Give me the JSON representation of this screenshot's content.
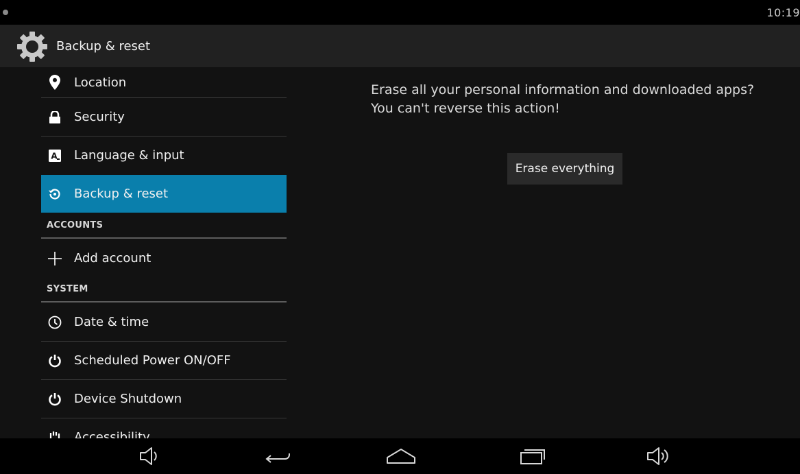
{
  "status_bar": {
    "time": "10:19"
  },
  "action_bar": {
    "title": "Backup & reset",
    "icon": "settings-gear-icon"
  },
  "sidebar": {
    "items": [
      {
        "label": "Location",
        "icon": "location-pin-icon"
      },
      {
        "label": "Security",
        "icon": "lock-icon"
      },
      {
        "label": "Language & input",
        "icon": "keyboard-letter-icon"
      },
      {
        "label": "Backup & reset",
        "icon": "backup-restore-icon",
        "selected": true
      },
      {
        "label": "Add account",
        "icon": "plus-icon"
      },
      {
        "label": "Date & time",
        "icon": "clock-icon"
      },
      {
        "label": "Scheduled Power ON/OFF",
        "icon": "power-icon"
      },
      {
        "label": "Device Shutdown",
        "icon": "power-icon"
      },
      {
        "label": "Accessibility",
        "icon": "hand-icon"
      }
    ],
    "headers": {
      "accounts": "ACCOUNTS",
      "system": "SYSTEM"
    },
    "selected_color": "#0a7fac"
  },
  "content": {
    "message": "Erase all your personal information and downloaded apps? You can't reverse this action!",
    "erase_button": "Erase everything"
  },
  "nav_bar": {
    "buttons": [
      "volume-down-icon",
      "back-icon",
      "home-icon",
      "recents-icon",
      "volume-up-icon"
    ]
  }
}
